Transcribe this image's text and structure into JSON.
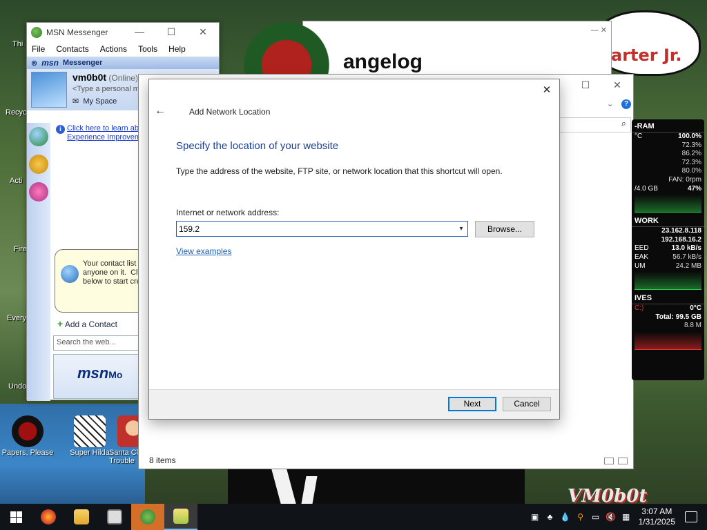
{
  "desktop": {
    "icons": [
      {
        "label": "Papers, Please"
      },
      {
        "label": "Super Hilda"
      },
      {
        "label": "Santa Cl\nTrouble"
      }
    ],
    "partial_labels": [
      "Thi",
      "Recyc",
      "Acti",
      "Fire",
      "Every",
      "Undo"
    ],
    "cloud_text": "arter Jr.",
    "watermark": "VM0b0t"
  },
  "msn": {
    "title": "MSN Messenger",
    "menu": [
      "File",
      "Contacts",
      "Actions",
      "Tools",
      "Help"
    ],
    "bar_logo": "msn",
    "bar_label": "Messenger",
    "user_name": "vm0b0t",
    "user_status": "(Online)",
    "personal_message": "<Type a personal m",
    "my_space": "My Space",
    "info_line1": "Click here to learn abo",
    "info_line2": "Experience Improvem",
    "bubble_text": "Your contact list c\nanyone on it.  Clic\nbelow to start cre",
    "add_contact": "Add a Contact",
    "search_placeholder": "Search the web...",
    "banner_logo": "msn",
    "banner_suffix": "Mo"
  },
  "changelog_window": {
    "title": "angelog"
  },
  "explorer": {
    "status": "8 items"
  },
  "dialog": {
    "title": "Add Network Location",
    "heading": "Specify the location of your website",
    "description": "Type the address of the website, FTP site, or network location that this shortcut will open.",
    "address_label": "Internet or network address:",
    "address_value": "159.2",
    "browse_label": "Browse...",
    "examples_link": "View examples",
    "next_label": "Next",
    "cancel_label": "Cancel"
  },
  "gadget": {
    "ram_header": "-RAM",
    "ram_rows": [
      {
        "k": "°C",
        "v": "100.0%"
      },
      {
        "k": "",
        "v": "72.3%"
      },
      {
        "k": "",
        "v": "86.2%"
      },
      {
        "k": "",
        "v": "72.3%"
      },
      {
        "k": "",
        "v": "80.0%"
      },
      {
        "k": "",
        "v": "FAN: 0rpm"
      }
    ],
    "ram_usage": {
      "k": "/4.0 GB",
      "v": "47%"
    },
    "net_header": "WORK",
    "net_rows": [
      {
        "k": "",
        "v": "23.162.8.118"
      },
      {
        "k": "",
        "v": "192.168.16.2"
      },
      {
        "k": "EED",
        "v": "13.0 kB/s"
      },
      {
        "k": "EAK",
        "v": "56.7 kB/s"
      },
      {
        "k": "UM",
        "v": "24.2 MB"
      }
    ],
    "drives_header": "IVES",
    "drive_rows": [
      {
        "k": "C:)",
        "v": "0°C"
      },
      {
        "k": "",
        "v": "Total: 99.5 GB"
      },
      {
        "k": "",
        "v": "8.8 M"
      }
    ]
  },
  "taskbar": {
    "time": "3:07 AM",
    "date": "1/31/2025"
  },
  "colors": {
    "accent": "#0078d7",
    "link": "#1a5fb4",
    "heading": "#1a3e93"
  }
}
